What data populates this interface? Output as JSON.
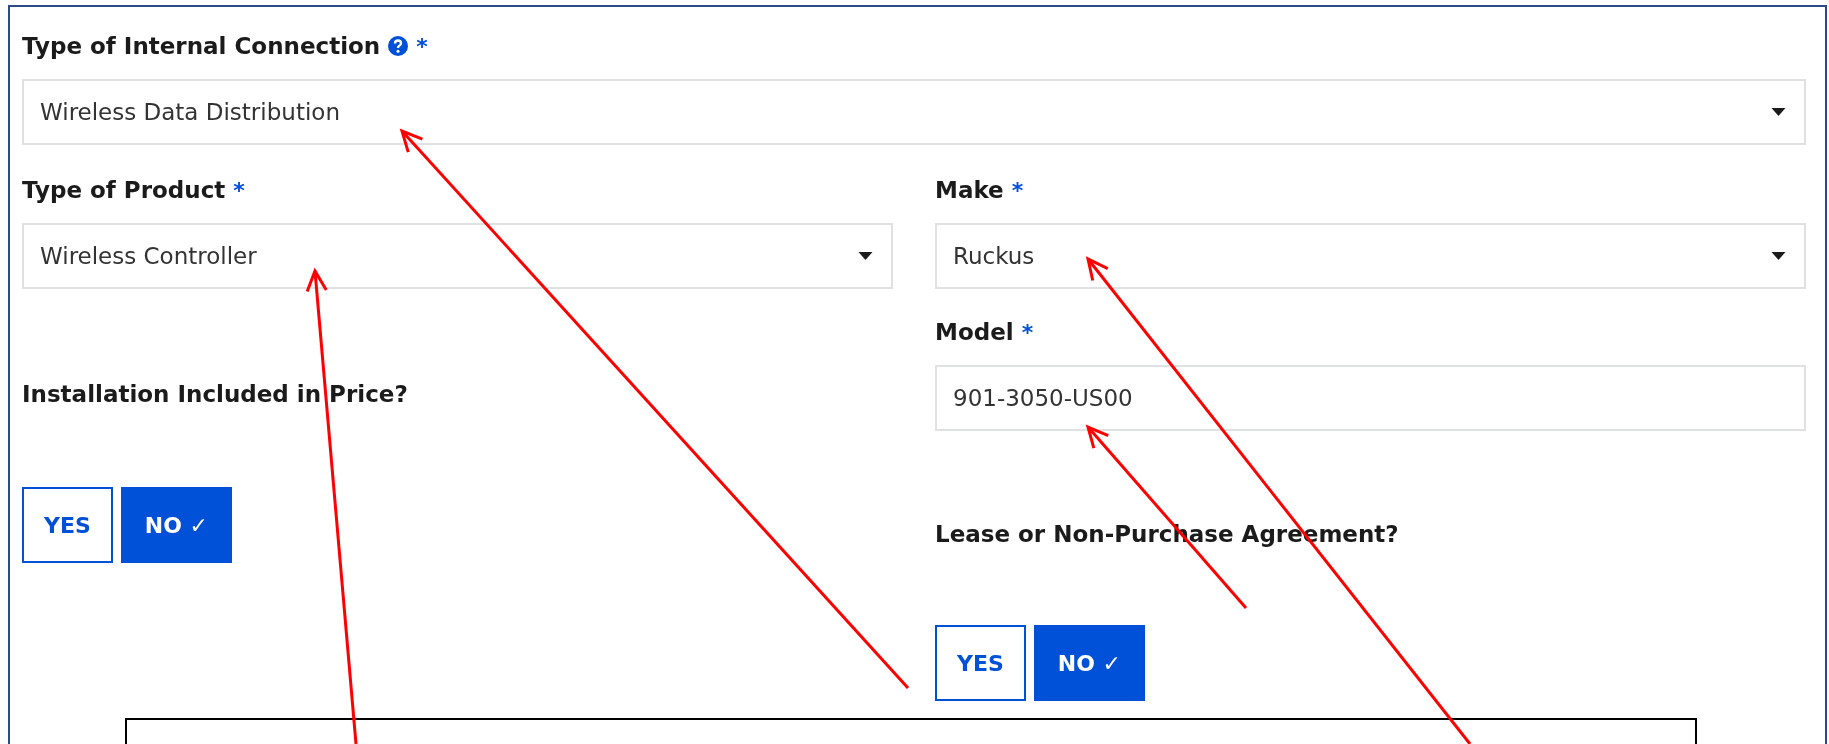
{
  "connection": {
    "label": "Type of Internal Connection",
    "help": true,
    "required_mark": "*",
    "kind": "select",
    "value": "Wireless Data Distribution"
  },
  "left": [
    {
      "label": "Type of Product",
      "required_mark": "*",
      "kind": "select",
      "value": "Wireless Controller"
    },
    {
      "label": "Installation Included in Price?",
      "kind": "toggle",
      "options": [
        {
          "label": "YES",
          "selected": false
        },
        {
          "label": "NO ✓",
          "selected": true
        }
      ]
    }
  ],
  "right": [
    {
      "label": "Make",
      "required_mark": "*",
      "kind": "select",
      "value": "Ruckus"
    },
    {
      "label": "Model",
      "required_mark": "*",
      "kind": "input",
      "value": "901-3050-US00"
    },
    {
      "label": "Lease or Non-Purchase Agreement?",
      "kind": "toggle",
      "options": [
        {
          "label": "YES",
          "selected": false
        },
        {
          "label": "NO ✓",
          "selected": true
        }
      ]
    }
  ]
}
